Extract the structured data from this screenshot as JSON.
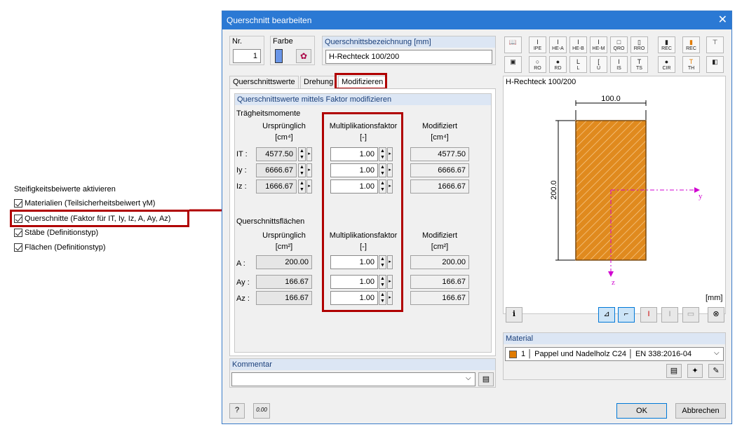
{
  "left_panel": {
    "title": "Steifigkeitsbeiwerte aktivieren",
    "items": [
      {
        "label": "Materialien (Teilsicherheitsbeiwert γM)"
      },
      {
        "label": "Querschnitte (Faktor für IT, Iy, Iz, A, Ay, Az)"
      },
      {
        "label": "Stäbe (Definitionstyp)"
      },
      {
        "label": "Flächen (Definitionstyp)"
      }
    ]
  },
  "dialog": {
    "title": "Querschnitt bearbeiten",
    "close": "✕",
    "nr_label": "Nr.",
    "nr_value": "1",
    "farbe_label": "Farbe",
    "bez_label": "Querschnittsbezeichnung [mm]",
    "bez_value": "H-Rechteck 100/200",
    "tabs": [
      "Querschnittswerte",
      "Drehung",
      "Modifizieren"
    ],
    "group_title": "Querschnittswerte mittels Faktor modifizieren",
    "traeg": {
      "title": "Trägheitsmomente",
      "h_orig": "Ursprünglich",
      "u_orig": "[cm⁴]",
      "h_mult": "Multiplikationsfaktor",
      "u_mult": "[-]",
      "h_mod": "Modifiziert",
      "u_mod": "[cm⁴]",
      "rows": [
        {
          "label": "IT :",
          "orig": "4577.50",
          "mult": "1.00",
          "mod": "4577.50"
        },
        {
          "label": "Iy :",
          "orig": "6666.67",
          "mult": "1.00",
          "mod": "6666.67"
        },
        {
          "label": "Iz :",
          "orig": "1666.67",
          "mult": "1.00",
          "mod": "1666.67"
        }
      ]
    },
    "flaech": {
      "title": "Querschnittsflächen",
      "h_orig": "Ursprünglich",
      "u_orig": "[cm²]",
      "h_mult": "Multiplikationsfaktor",
      "u_mult": "[-]",
      "h_mod": "Modifiziert",
      "u_mod": "[cm²]",
      "rows": [
        {
          "label": "A :",
          "orig": "200.00",
          "mult": "1.00",
          "mod": "200.00"
        },
        {
          "label": "Ay :",
          "orig": "166.67",
          "mult": "1.00",
          "mod": "166.67"
        },
        {
          "label": "Az :",
          "orig": "166.67",
          "mult": "1.00",
          "mod": "166.67"
        }
      ]
    },
    "kommentar_label": "Kommentar",
    "preview": {
      "title": "H-Rechteck 100/200",
      "dim_top": "100.0",
      "dim_left": "200.0",
      "axis_y": "y",
      "axis_z": "z",
      "unit": "[mm]"
    },
    "toolbar_row1": [
      "",
      "IPE",
      "HE-A",
      "HE-B",
      "HE-M",
      "QRO",
      "RRO",
      "REC",
      "REC",
      ""
    ],
    "toolbar_row2": [
      "",
      "RO",
      "RD",
      "L",
      "U",
      "IS",
      "TS",
      "CIR",
      "TH",
      ""
    ],
    "material_label": "Material",
    "material_value": "1 │ Pappel und Nadelholz C24 │ EN 338:2016-04",
    "material_color": "#e07b00",
    "ok_label": "OK",
    "cancel_label": "Abbrechen"
  }
}
